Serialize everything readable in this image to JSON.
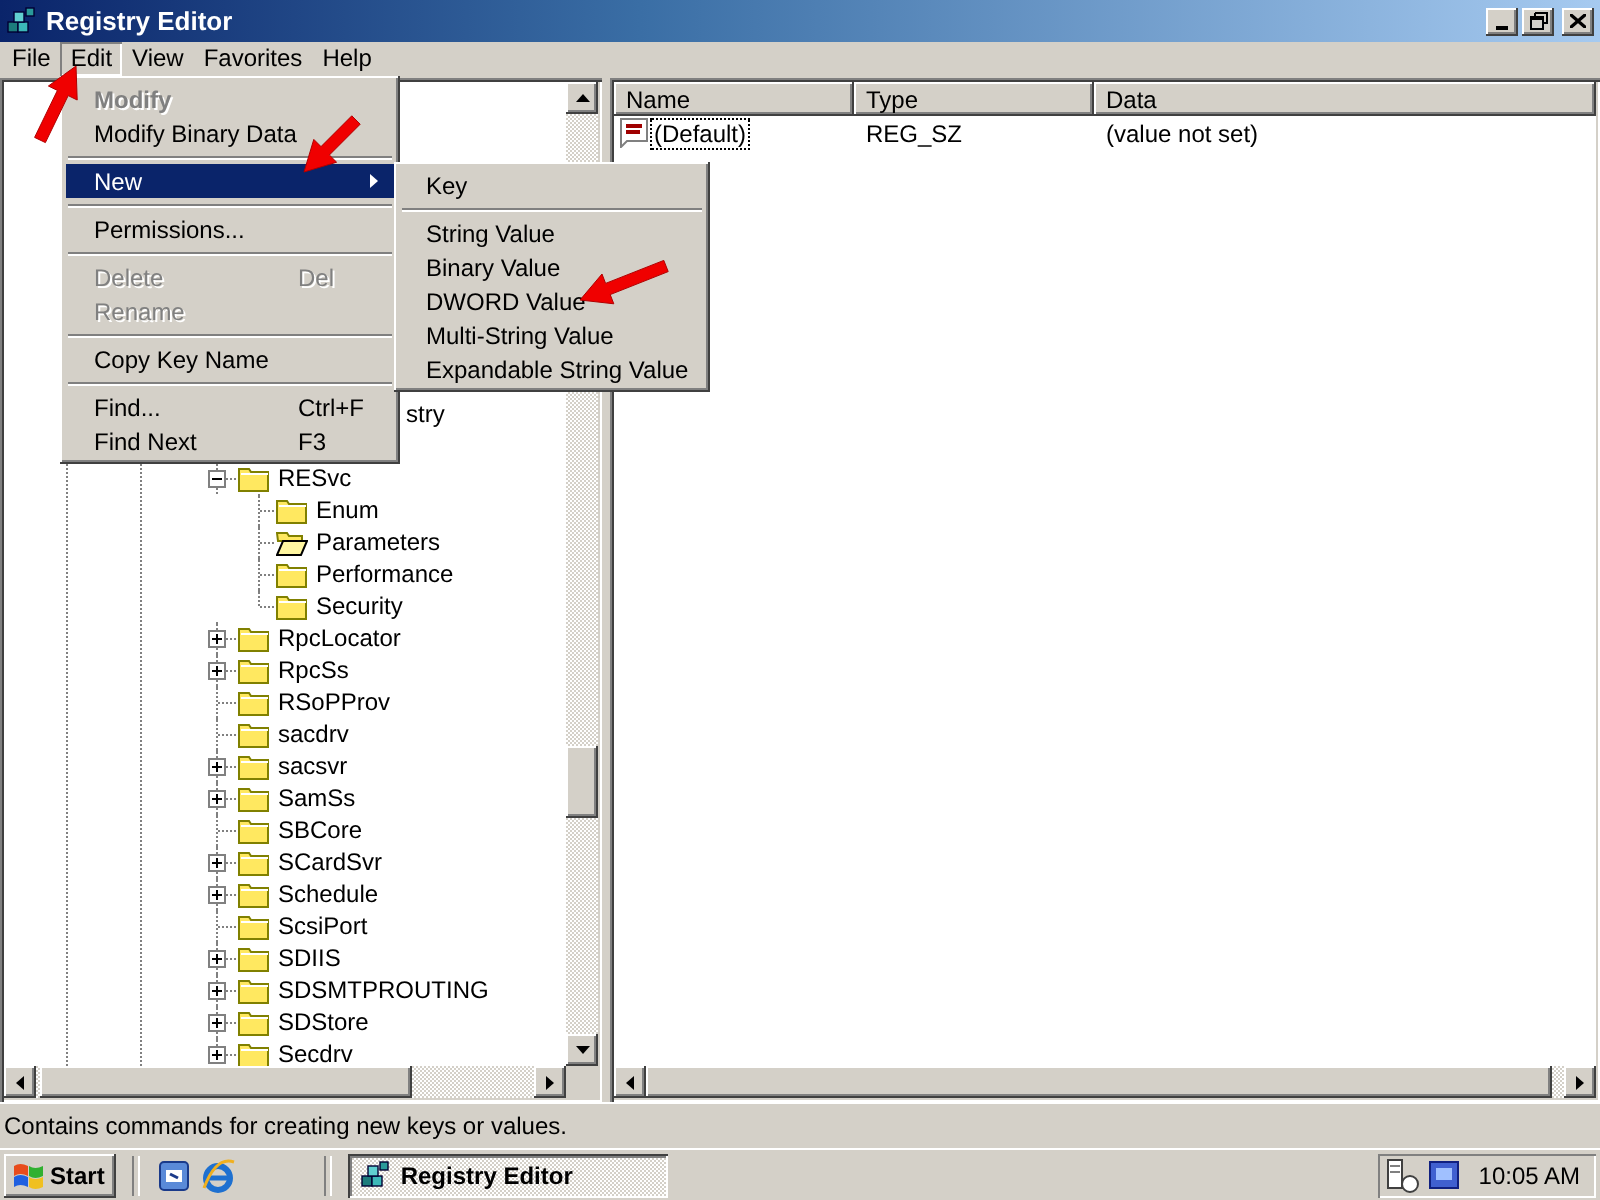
{
  "window": {
    "title": "Registry Editor"
  },
  "menubar": [
    {
      "label": "File",
      "selected": false
    },
    {
      "label": "Edit",
      "selected": true
    },
    {
      "label": "View",
      "selected": false
    },
    {
      "label": "Favorites",
      "selected": false
    },
    {
      "label": "Help",
      "selected": false
    }
  ],
  "edit_menu": [
    {
      "kind": "item",
      "label": "Modify",
      "default": true,
      "disabled": true,
      "submenu": false,
      "selected": false
    },
    {
      "kind": "item",
      "label": "Modify Binary Data",
      "default": false,
      "disabled": false,
      "submenu": false,
      "selected": false
    },
    {
      "kind": "separator"
    },
    {
      "kind": "item",
      "label": "New",
      "default": false,
      "disabled": false,
      "submenu": true,
      "selected": true
    },
    {
      "kind": "separator"
    },
    {
      "kind": "item",
      "label": "Permissions...",
      "default": false,
      "disabled": false,
      "submenu": false,
      "selected": false
    },
    {
      "kind": "separator"
    },
    {
      "kind": "item",
      "label": "Delete",
      "shortcut": "Del",
      "default": false,
      "disabled": true,
      "submenu": false,
      "selected": false
    },
    {
      "kind": "item",
      "label": "Rename",
      "default": false,
      "disabled": true,
      "submenu": false,
      "selected": false
    },
    {
      "kind": "separator"
    },
    {
      "kind": "item",
      "label": "Copy Key Name",
      "default": false,
      "disabled": false,
      "submenu": false,
      "selected": false
    },
    {
      "kind": "separator"
    },
    {
      "kind": "item",
      "label": "Find...",
      "shortcut": "Ctrl+F",
      "default": false,
      "disabled": false,
      "submenu": false,
      "selected": false
    },
    {
      "kind": "item",
      "label": "Find Next",
      "shortcut": "F3",
      "default": false,
      "disabled": false,
      "submenu": false,
      "selected": false
    }
  ],
  "new_submenu": [
    {
      "kind": "item",
      "label": "Key"
    },
    {
      "kind": "separator"
    },
    {
      "kind": "item",
      "label": "String Value"
    },
    {
      "kind": "item",
      "label": "Binary Value"
    },
    {
      "kind": "item",
      "label": "DWORD Value"
    },
    {
      "kind": "item",
      "label": "Multi-String Value"
    },
    {
      "kind": "item",
      "label": "Expandable String Value"
    }
  ],
  "tree": {
    "items": [
      {
        "kind": "cut",
        "label": "stry"
      },
      {
        "kind": "key",
        "label": "RESvc",
        "expandable": true,
        "expanded": true,
        "children": [
          {
            "label": "Enum",
            "selected": false
          },
          {
            "label": "Parameters",
            "selected": true
          },
          {
            "label": "Performance",
            "selected": false
          },
          {
            "label": "Security",
            "selected": false
          }
        ]
      },
      {
        "kind": "key",
        "label": "RpcLocator",
        "expandable": true,
        "expanded": false
      },
      {
        "kind": "key",
        "label": "RpcSs",
        "expandable": true,
        "expanded": false
      },
      {
        "kind": "key",
        "label": "RSoPProv",
        "expandable": false
      },
      {
        "kind": "key",
        "label": "sacdrv",
        "expandable": false
      },
      {
        "kind": "key",
        "label": "sacsvr",
        "expandable": true,
        "expanded": false
      },
      {
        "kind": "key",
        "label": "SamSs",
        "expandable": true,
        "expanded": false
      },
      {
        "kind": "key",
        "label": "SBCore",
        "expandable": false
      },
      {
        "kind": "key",
        "label": "SCardSvr",
        "expandable": true,
        "expanded": false
      },
      {
        "kind": "key",
        "label": "Schedule",
        "expandable": true,
        "expanded": false
      },
      {
        "kind": "key",
        "label": "ScsiPort",
        "expandable": false
      },
      {
        "kind": "key",
        "label": "SDIIS",
        "expandable": true,
        "expanded": false
      },
      {
        "kind": "key",
        "label": "SDSMTPROUTING",
        "expandable": true,
        "expanded": false
      },
      {
        "kind": "key",
        "label": "SDStore",
        "expandable": true,
        "expanded": false
      },
      {
        "kind": "key",
        "label": "Secdrv",
        "expandable": true,
        "expanded": false
      }
    ]
  },
  "values_list": {
    "columns": [
      "Name",
      "Type",
      "Data"
    ],
    "rows": [
      {
        "name": "(Default)",
        "type": "REG_SZ",
        "data": "(value not set)"
      }
    ]
  },
  "status_bar": "Contains commands for creating new keys or values.",
  "taskbar": {
    "start": "Start",
    "tasks": [
      {
        "label": "Registry Editor",
        "selected": true
      }
    ],
    "clock": "10:05 AM"
  }
}
